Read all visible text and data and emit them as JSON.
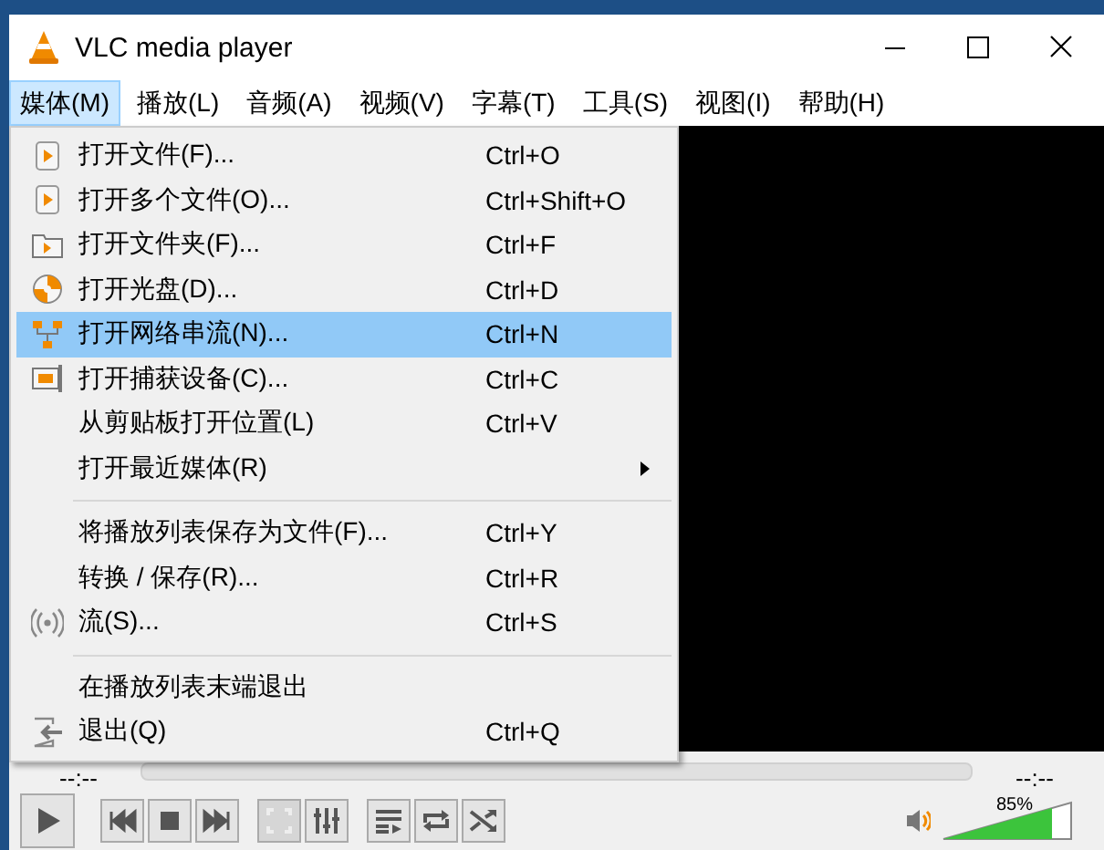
{
  "window": {
    "title": "VLC media player"
  },
  "menubar": [
    {
      "label": "媒体(M)",
      "selected": true
    },
    {
      "label": "播放(L)",
      "selected": false
    },
    {
      "label": "音频(A)",
      "selected": false
    },
    {
      "label": "视频(V)",
      "selected": false
    },
    {
      "label": "字幕(T)",
      "selected": false
    },
    {
      "label": "工具(S)",
      "selected": false
    },
    {
      "label": "视图(I)",
      "selected": false
    },
    {
      "label": "帮助(H)",
      "selected": false
    }
  ],
  "menu": {
    "items": [
      {
        "kind": "item",
        "label": "打开文件(F)...",
        "shortcut": "Ctrl+O",
        "selected": false
      },
      {
        "kind": "item",
        "label": "打开多个文件(O)...",
        "shortcut": "Ctrl+Shift+O",
        "selected": false
      },
      {
        "kind": "item",
        "label": "打开文件夹(F)...",
        "shortcut": "Ctrl+F",
        "selected": false
      },
      {
        "kind": "item",
        "label": "打开光盘(D)...",
        "shortcut": "Ctrl+D",
        "selected": false
      },
      {
        "kind": "item",
        "label": "打开网络串流(N)...",
        "shortcut": "Ctrl+N",
        "selected": true
      },
      {
        "kind": "item",
        "label": "打开捕获设备(C)...",
        "shortcut": "Ctrl+C",
        "selected": false
      },
      {
        "kind": "item",
        "label": "从剪贴板打开位置(L)",
        "shortcut": "Ctrl+V",
        "selected": false
      },
      {
        "kind": "submenu",
        "label": "打开最近媒体(R)",
        "selected": false
      },
      {
        "kind": "separator"
      },
      {
        "kind": "item",
        "label": "将播放列表保存为文件(F)...",
        "shortcut": "Ctrl+Y",
        "selected": false
      },
      {
        "kind": "item",
        "label": "转换 / 保存(R)...",
        "shortcut": "Ctrl+R",
        "selected": false
      },
      {
        "kind": "item",
        "label": "流(S)...",
        "shortcut": "Ctrl+S",
        "selected": false
      },
      {
        "kind": "separator"
      },
      {
        "kind": "item",
        "label": "在播放列表末端退出",
        "selected": false
      },
      {
        "kind": "item",
        "label": "退出(Q)",
        "shortcut": "Ctrl+Q",
        "selected": false
      }
    ]
  },
  "player": {
    "time_elapsed": "--:--",
    "time_total": "--:--",
    "volume": {
      "level": 0.85,
      "reading": "85%"
    }
  }
}
